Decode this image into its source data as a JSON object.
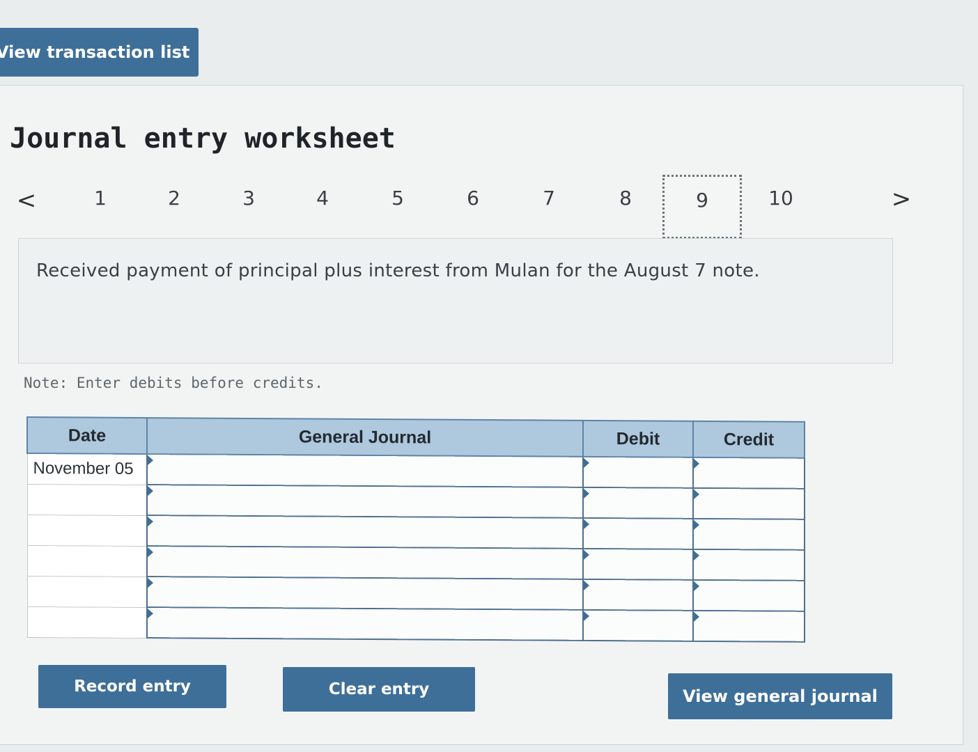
{
  "toolbar": {
    "view_transaction_list": "View transaction list"
  },
  "worksheet": {
    "title": "Journal entry worksheet",
    "nav": {
      "prev": "<",
      "next": ">",
      "steps": [
        "1",
        "2",
        "3",
        "4",
        "5",
        "6",
        "7",
        "8",
        "9",
        "10"
      ],
      "active_step": "9"
    },
    "description": "Received payment of principal plus interest from Mulan for the August 7 note.",
    "note": "Note: Enter debits before credits."
  },
  "journal": {
    "headers": {
      "date": "Date",
      "general_journal": "General Journal",
      "debit": "Debit",
      "credit": "Credit"
    },
    "rows": [
      {
        "date": "November 05",
        "account": "",
        "debit": "",
        "credit": ""
      },
      {
        "date": "",
        "account": "",
        "debit": "",
        "credit": ""
      },
      {
        "date": "",
        "account": "",
        "debit": "",
        "credit": ""
      },
      {
        "date": "",
        "account": "",
        "debit": "",
        "credit": ""
      },
      {
        "date": "",
        "account": "",
        "debit": "",
        "credit": ""
      },
      {
        "date": "",
        "account": "",
        "debit": "",
        "credit": ""
      }
    ]
  },
  "buttons": {
    "record_entry": "Record entry",
    "clear_entry": "Clear entry",
    "view_general_journal": "View general journal"
  },
  "colors": {
    "accent_button": "#3e6f99",
    "table_header": "#aec8de",
    "table_border": "#4d6f90"
  }
}
